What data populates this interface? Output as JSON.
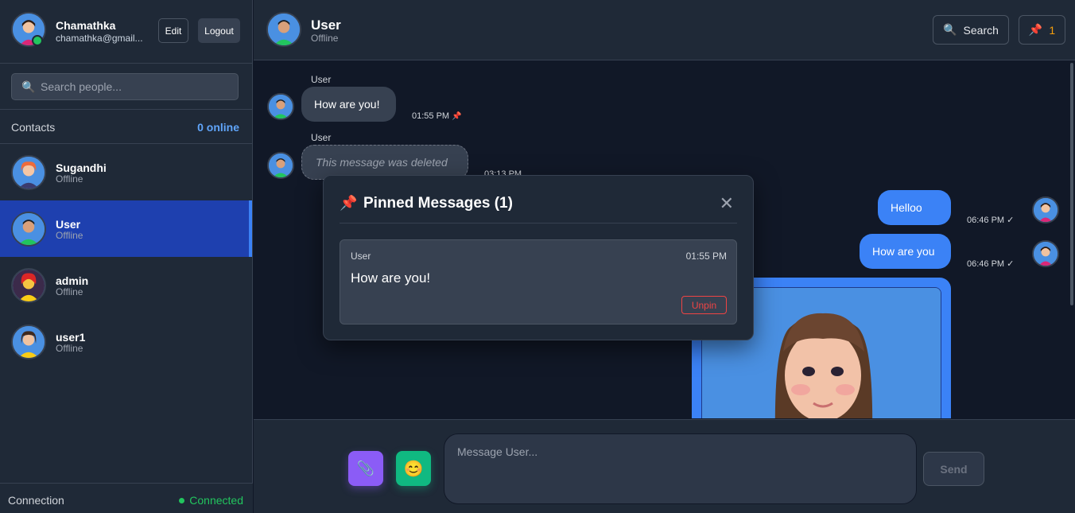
{
  "profile": {
    "name": "Chamathka",
    "email": "chamathka@gmail...",
    "edit_label": "Edit",
    "logout_label": "Logout"
  },
  "search": {
    "placeholder": "Search people..."
  },
  "contacts": {
    "label": "Contacts",
    "online_count": "0 online",
    "items": [
      {
        "name": "Sugandhi",
        "status": "Offline"
      },
      {
        "name": "User",
        "status": "Offline"
      },
      {
        "name": "admin",
        "status": "Offline"
      },
      {
        "name": "user1",
        "status": "Offline"
      }
    ]
  },
  "connection": {
    "label": "Connection",
    "status": "Connected"
  },
  "chat_header": {
    "title": "User",
    "subtitle": "Offline",
    "search_label": "Search",
    "pins_count": "1"
  },
  "messages": [
    {
      "sender": "User",
      "text": "How are you!",
      "time": "01:55 PM",
      "pinned": true
    },
    {
      "sender": "User",
      "text": "This message was deleted",
      "time": "03:13 PM"
    },
    {
      "text": "Helloo",
      "time": "06:46 PM ✓"
    },
    {
      "text": "How are you",
      "time": "06:46 PM ✓"
    }
  ],
  "composer": {
    "placeholder": "Message User...",
    "send_label": "Send"
  },
  "pinned_modal": {
    "title": "Pinned Messages (1)",
    "item": {
      "sender": "User",
      "time": "01:55 PM",
      "text": "How are you!",
      "unpin_label": "Unpin"
    }
  },
  "colors": {
    "accent": "#3b82f6",
    "online": "#22c55e",
    "danger": "#ef4444",
    "attach": "#8b5cf6",
    "emoji": "#10b981"
  },
  "icons": [
    "search-icon",
    "pin-icon",
    "close-icon",
    "paperclip-icon",
    "smile-icon"
  ]
}
